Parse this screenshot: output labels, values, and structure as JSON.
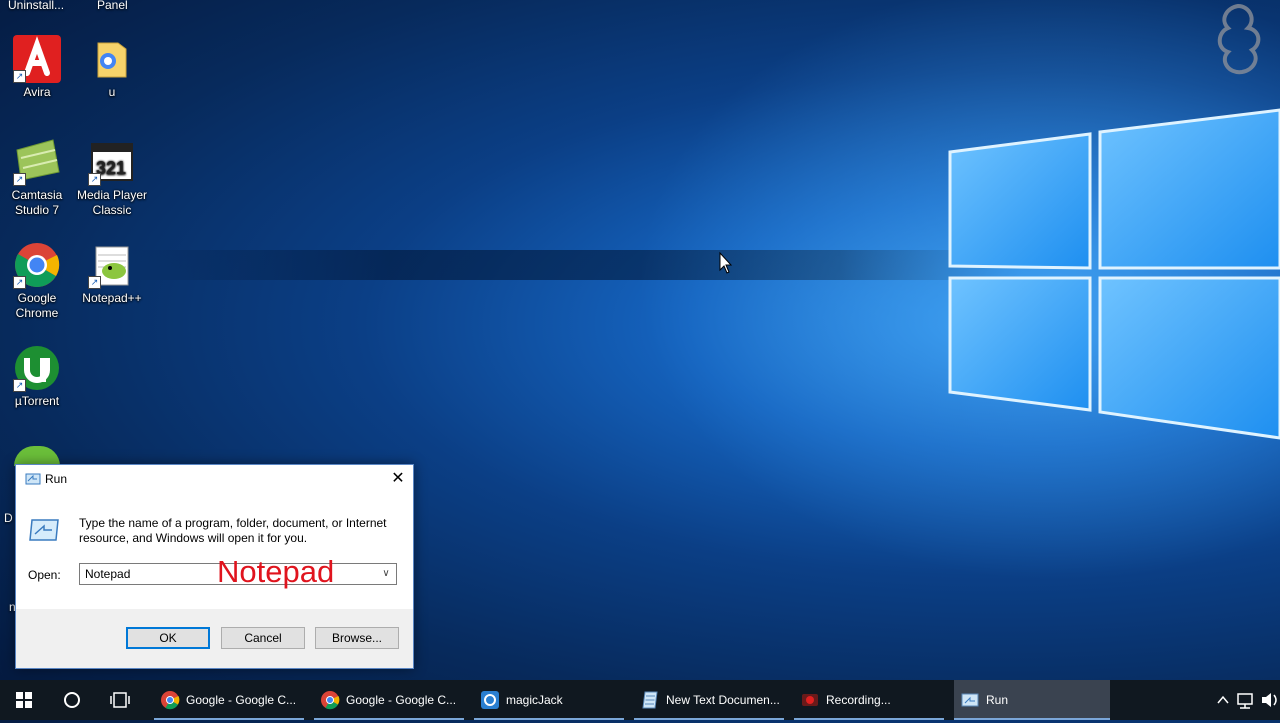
{
  "desktop": {
    "top_labels": [
      "Uninstall...",
      "Panel"
    ],
    "icons": [
      {
        "id": "avira",
        "label": "Avira"
      },
      {
        "id": "u",
        "label": "u"
      },
      {
        "id": "camtasia",
        "label": "Camtasia Studio 7"
      },
      {
        "id": "mpc",
        "label": "Media Player Classic"
      },
      {
        "id": "chrome",
        "label": "Google Chrome"
      },
      {
        "id": "notepadpp",
        "label": "Notepad++"
      },
      {
        "id": "utorrent",
        "label": "µTorrent"
      }
    ],
    "partial_labels": [
      "D",
      "n"
    ]
  },
  "run_dialog": {
    "title": "Run",
    "description": "Type the name of a program, folder, document, or Internet resource, and Windows will open it for you.",
    "open_label": "Open:",
    "open_value": "Notepad",
    "overlay_text": "Notepad",
    "ok_label": "OK",
    "cancel_label": "Cancel",
    "browse_label": "Browse..."
  },
  "taskbar": {
    "items": [
      {
        "icon": "chrome-icon",
        "label": "Google - Google C..."
      },
      {
        "icon": "chrome-icon",
        "label": "Google - Google C..."
      },
      {
        "icon": "magicjack-icon",
        "label": "magicJack"
      },
      {
        "icon": "notepad-icon",
        "label": "New Text Documen..."
      },
      {
        "icon": "recorder-icon",
        "label": "Recording..."
      },
      {
        "icon": "run-icon",
        "label": "Run"
      }
    ]
  },
  "colors": {
    "accent": "#0078d7",
    "overlay_red": "#e0141e",
    "taskbar": "#101820"
  }
}
